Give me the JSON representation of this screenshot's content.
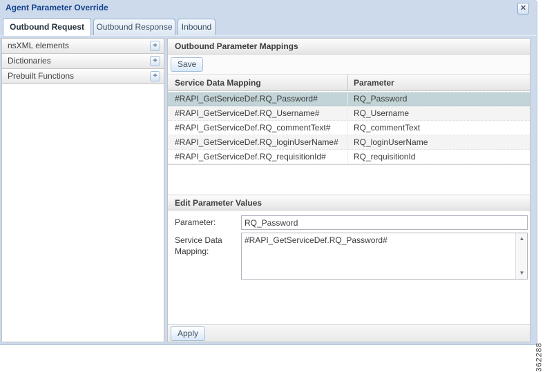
{
  "window": {
    "title": "Agent Parameter Override",
    "close_icon": "✕",
    "figure_number": "362288"
  },
  "tabs": [
    {
      "label": "Outbound Request"
    },
    {
      "label": "Outbound Response"
    },
    {
      "label": "Inbound"
    }
  ],
  "sidebar": {
    "expand_icon": "+",
    "sections": [
      {
        "label": "nsXML elements"
      },
      {
        "label": "Dictionaries"
      },
      {
        "label": "Prebuilt Functions"
      }
    ]
  },
  "main": {
    "header": "Outbound Parameter Mappings",
    "save_button": "Save",
    "table": {
      "columns": {
        "mapping": "Service Data Mapping",
        "parameter": "Parameter"
      },
      "rows": [
        {
          "mapping": "#RAPI_GetServiceDef.RQ_Password#",
          "parameter": "RQ_Password"
        },
        {
          "mapping": "#RAPI_GetServiceDef.RQ_Username#",
          "parameter": "RQ_Username"
        },
        {
          "mapping": "#RAPI_GetServiceDef.RQ_commentText#",
          "parameter": "RQ_commentText"
        },
        {
          "mapping": "#RAPI_GetServiceDef.RQ_loginUserName#",
          "parameter": "RQ_loginUserName"
        },
        {
          "mapping": "#RAPI_GetServiceDef.RQ_requisitionId#",
          "parameter": "RQ_requisitionId"
        }
      ]
    },
    "edit": {
      "header": "Edit Parameter Values",
      "parameter_label": "Parameter:",
      "parameter_value": "RQ_Password",
      "mapping_label": "Service Data Mapping:",
      "mapping_value": "#RAPI_GetServiceDef.RQ_Password#"
    },
    "apply_button": "Apply"
  },
  "icons": {
    "scroll_up": "▲",
    "scroll_down": "▼"
  },
  "colors": {
    "dialog_chrome": "#ccdaec",
    "title_text": "#15428b",
    "selected_row": "#c2d4d7"
  }
}
